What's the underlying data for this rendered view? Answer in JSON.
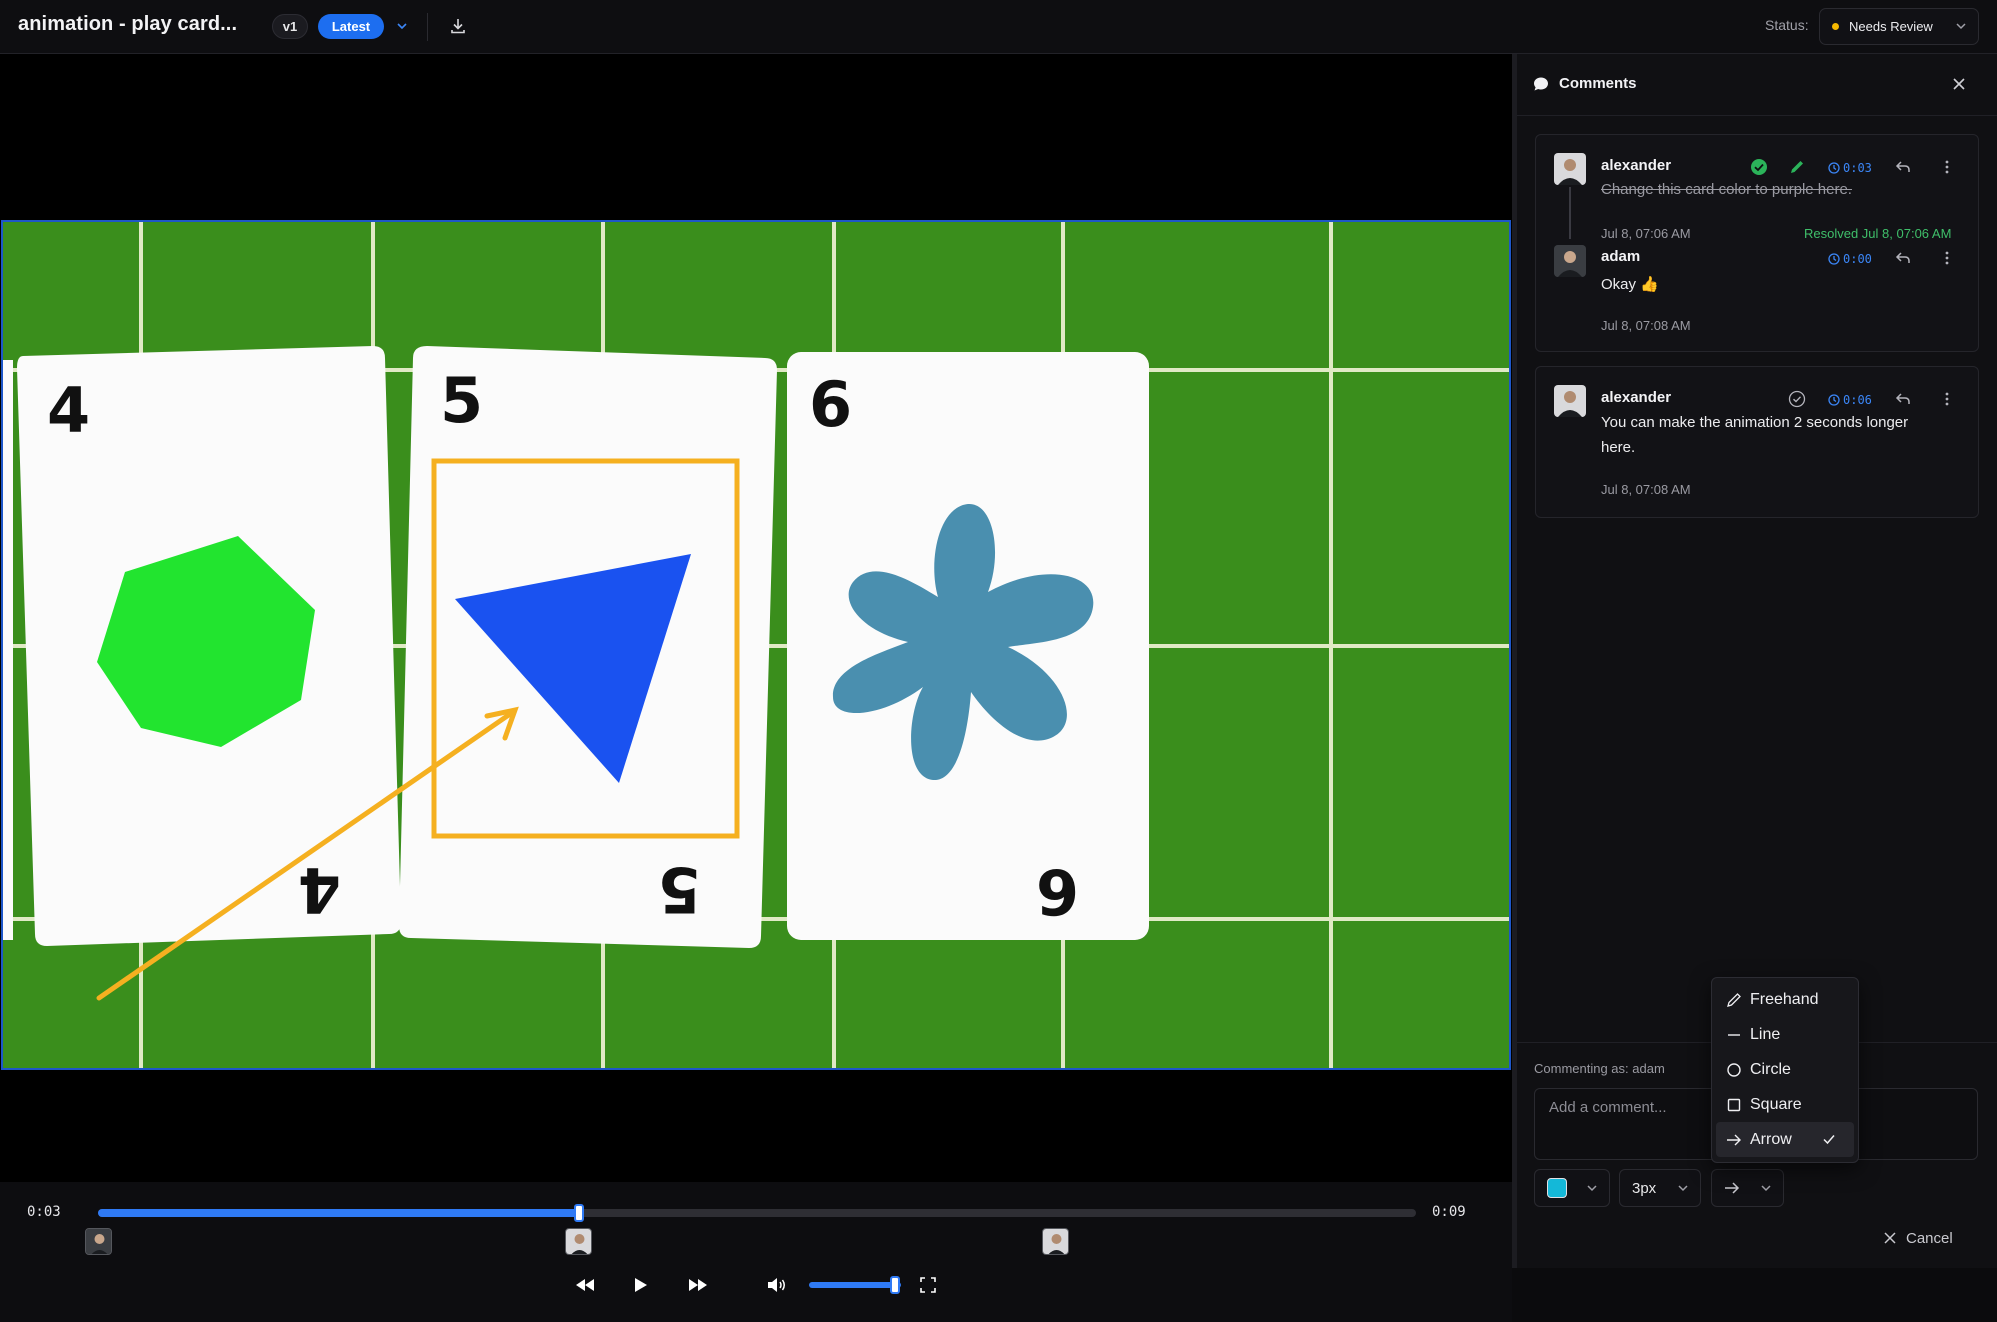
{
  "header": {
    "title": "animation - play card...",
    "version_label": "v1",
    "latest_label": "Latest",
    "status_label": "Status:",
    "status_value": "Needs Review",
    "status_color": "#f5b800"
  },
  "video": {
    "cards": [
      {
        "rank": "4",
        "shape": "green-heptagon-star",
        "color": "#22e42f"
      },
      {
        "rank": "5",
        "shape": "blue-triangle",
        "color": "#1a52f0"
      },
      {
        "rank": "6",
        "shape": "teal-flower",
        "color": "#4a8faf"
      }
    ],
    "annotation_color": "#f5b020",
    "felt_color": "#3a8e1c"
  },
  "player": {
    "current_time": "0:03",
    "duration": "0:09",
    "progress_fraction": 0.365,
    "volume_fraction": 0.9,
    "accent_color": "#2f7af5"
  },
  "comments_panel": {
    "title": "Comments",
    "threads": [
      {
        "author": "alexander",
        "timestamp": "0:03",
        "text": "Change this card color to purple here.",
        "date": "Jul 8, 07:06 AM",
        "resolved_text": "Resolved Jul 8, 07:06 AM",
        "resolved": true,
        "reply": {
          "author": "adam",
          "timestamp": "0:00",
          "text": "Okay 👍",
          "date": "Jul 8, 07:08 AM"
        }
      },
      {
        "author": "alexander",
        "timestamp": "0:06",
        "text_line1": "You can make the animation 2 seconds longer",
        "text_line2": "here.",
        "date": "Jul 8, 07:08 AM",
        "resolved": false
      }
    ],
    "commenting_as": "Commenting as: adam",
    "input_placeholder": "Add a comment...",
    "stroke_width": "3px",
    "draw_color": "#14b8d8",
    "cancel_label": "Cancel"
  },
  "draw_tool_menu": {
    "items": [
      "Freehand",
      "Line",
      "Circle",
      "Square",
      "Arrow"
    ],
    "selected": "Arrow"
  }
}
